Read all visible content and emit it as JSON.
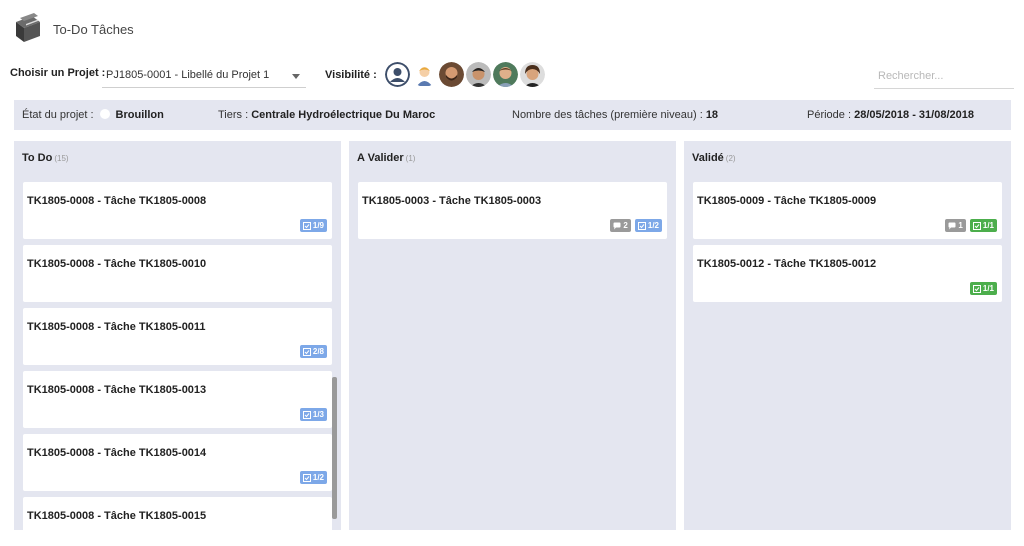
{
  "app": {
    "title": "To-Do Tâches",
    "icon": "folder-stack-icon"
  },
  "toolbar": {
    "project_label": "Choisir un Projet :",
    "project_value": "PJ1805-0001 - Libellé du Projet 1",
    "visibility_label": "Visibilité :",
    "avatars": [
      "default-user-avatar",
      "user-avatar-blond",
      "user-avatar-beard",
      "user-avatar-dark-hair",
      "user-avatar-smiling",
      "user-avatar-curly"
    ],
    "search_placeholder": "Rechercher..."
  },
  "info": {
    "state_label": "État du projet :",
    "state_value": "Brouillon",
    "tiers_label": "Tiers :",
    "tiers_value": "Centrale Hydroélectrique Du Maroc",
    "tasks_label": "Nombre des tâches (première niveau) :",
    "tasks_value": "18",
    "period_label": "Période :",
    "period_value": "28/05/2018 - 31/08/2018"
  },
  "columns": [
    {
      "title": "To Do",
      "count": "(15)",
      "cards": [
        {
          "title": "TK1805-0008 - Tâche TK1805-0008",
          "comments": "",
          "checklist": "1/9",
          "check_color": "blue"
        },
        {
          "title": "TK1805-0008 - Tâche TK1805-0010",
          "comments": "",
          "checklist": "",
          "check_color": "blue"
        },
        {
          "title": "TK1805-0008 - Tâche TK1805-0011",
          "comments": "",
          "checklist": "2/8",
          "check_color": "blue"
        },
        {
          "title": "TK1805-0008 - Tâche TK1805-0013",
          "comments": "",
          "checklist": "1/3",
          "check_color": "blue"
        },
        {
          "title": "TK1805-0008 - Tâche TK1805-0014",
          "comments": "",
          "checklist": "1/2",
          "check_color": "blue"
        },
        {
          "title": "TK1805-0008 - Tâche TK1805-0015",
          "comments": "",
          "checklist": "",
          "check_color": "blue"
        }
      ]
    },
    {
      "title": "A Valider",
      "count": "(1)",
      "cards": [
        {
          "title": "TK1805-0003 - Tâche TK1805-0003",
          "comments": "2",
          "checklist": "1/2",
          "check_color": "blue"
        }
      ]
    },
    {
      "title": "Validé",
      "count": "(2)",
      "cards": [
        {
          "title": "TK1805-0009 - Tâche TK1805-0009",
          "comments": "1",
          "checklist": "1/1",
          "check_color": "green"
        },
        {
          "title": "TK1805-0012 - Tâche TK1805-0012",
          "comments": "",
          "checklist": "1/1",
          "check_color": "green"
        }
      ]
    }
  ]
}
